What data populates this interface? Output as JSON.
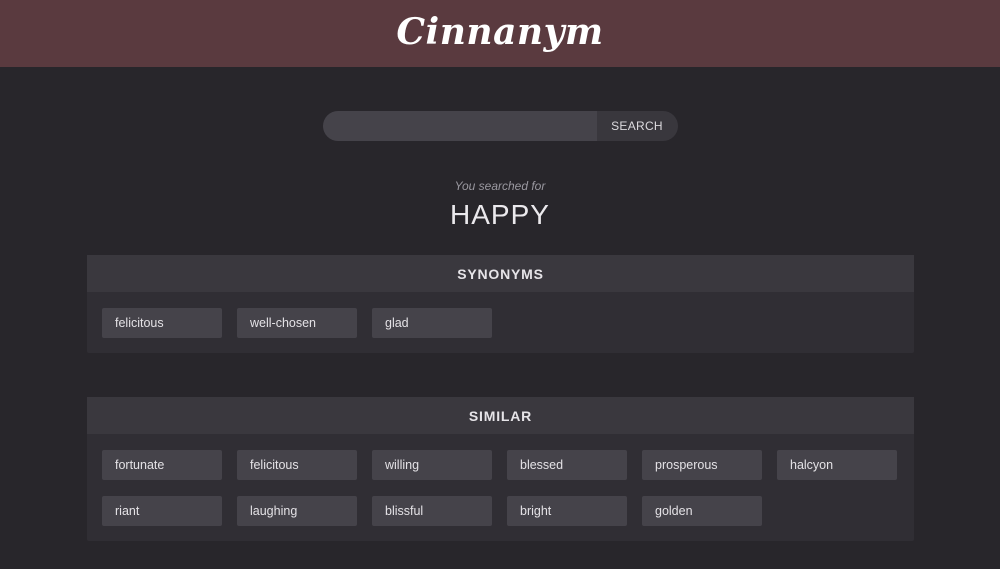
{
  "app": {
    "title": "Cinnanym"
  },
  "search": {
    "value": "",
    "placeholder": "",
    "button_label": "SEARCH"
  },
  "result": {
    "intro": "You searched for",
    "word": "HAPPY"
  },
  "synonyms": {
    "title": "SYNONYMS",
    "items": [
      "felicitous",
      "well-chosen",
      "glad"
    ]
  },
  "similar": {
    "title": "SIMILAR",
    "items": [
      "fortunate",
      "felicitous",
      "willing",
      "blessed",
      "prosperous",
      "halcyon",
      "riant",
      "laughing",
      "blissful",
      "bright",
      "golden"
    ]
  },
  "colors": {
    "header_bg": "#5a3a3f",
    "page_bg": "#28262b",
    "panel_bg": "#302e34",
    "chip_bg": "#45434a"
  }
}
